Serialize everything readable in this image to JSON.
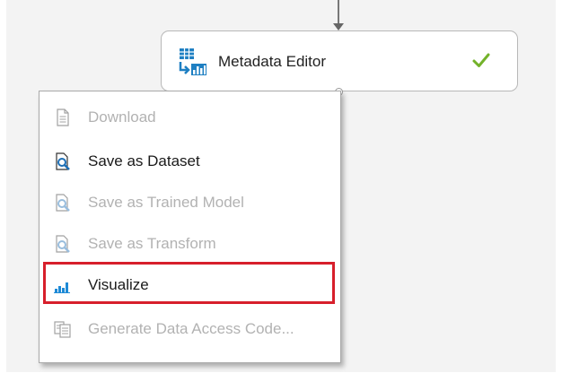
{
  "module": {
    "title": "Metadata Editor",
    "icon": "metadata-editor-icon",
    "status_icon": "checkmark-icon",
    "status_color": "#73b22a"
  },
  "context_menu": {
    "items": [
      {
        "label": "Download",
        "icon": "document-icon",
        "enabled": false
      },
      {
        "label": "Save as Dataset",
        "icon": "save-dataset-icon",
        "enabled": true
      },
      {
        "label": "Save as Trained Model",
        "icon": "save-model-icon",
        "enabled": false
      },
      {
        "label": "Save as Transform",
        "icon": "save-transform-icon",
        "enabled": false
      },
      {
        "label": "Visualize",
        "icon": "visualize-bar-chart-icon",
        "enabled": true,
        "highlighted": true
      },
      {
        "label": "Generate Data Access Code...",
        "icon": "copy-code-icon",
        "enabled": false
      }
    ],
    "highlight_color": "#d71f2b"
  }
}
